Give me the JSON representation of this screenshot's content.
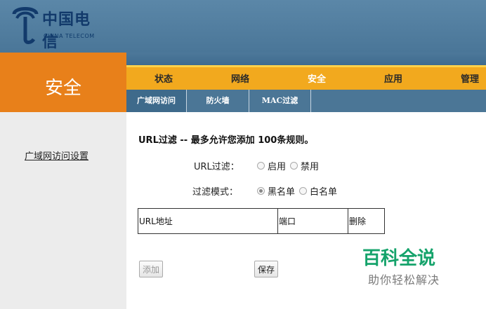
{
  "brand": {
    "name_cn": "中国电信",
    "name_en": "CHINA TELECOM",
    "logo_color": "#123a6b"
  },
  "section_title": "安全",
  "main_nav": [
    {
      "label": "状态",
      "active": false
    },
    {
      "label": "网络",
      "active": false
    },
    {
      "label": "安全",
      "active": true
    },
    {
      "label": "应用",
      "active": false
    },
    {
      "label": "管理",
      "active": false
    }
  ],
  "sub_nav": [
    {
      "label": "广域网访问",
      "active": true
    },
    {
      "label": "防火墙",
      "active": false
    },
    {
      "label": "MAC过滤",
      "active": false
    }
  ],
  "sidebar": {
    "link": "广域网访问设置"
  },
  "content": {
    "title": "URL过滤 -- 最多允许您添加 100条规则。",
    "filter": {
      "label": "URL过滤：",
      "options": [
        "启用",
        "禁用"
      ],
      "selected": null
    },
    "mode": {
      "label": "过滤模式：",
      "options": [
        "黑名单",
        "白名单"
      ],
      "selected": "黑名单"
    },
    "table": {
      "columns": [
        "URL地址",
        "端口",
        "删除"
      ]
    },
    "buttons": {
      "add": "添加",
      "save": "保存"
    }
  },
  "watermark": {
    "main": "百科全说",
    "sub": "助你轻松解决"
  },
  "colors": {
    "header": "#5b87a8",
    "accent": "#e8801a",
    "nav": "#f2a91e",
    "subnav": "#4b7696",
    "sidebar": "#ececec",
    "watermark": "#15a36b"
  }
}
